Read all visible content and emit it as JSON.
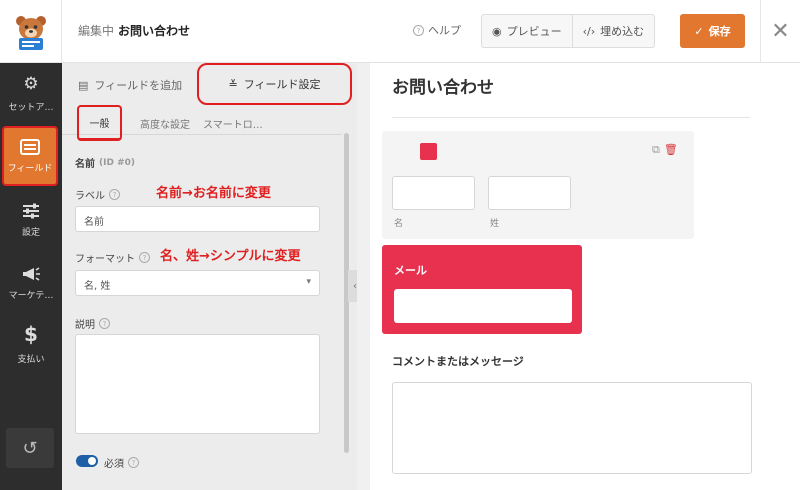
{
  "header": {
    "editing_label": "編集中",
    "form_name": "お問い合わせ",
    "help": "ヘルプ",
    "preview": "プレビュー",
    "embed": "埋め込む",
    "save": "保存",
    "save_color": "#e27730"
  },
  "sidebar": {
    "items": [
      {
        "label": "セットア…",
        "icon": "gear-icon"
      },
      {
        "label": "フィールド",
        "icon": "fields-icon"
      },
      {
        "label": "設定",
        "icon": "sliders-icon"
      },
      {
        "label": "マーケテ…",
        "icon": "megaphone-icon"
      },
      {
        "label": "支払い",
        "icon": "dollar-icon"
      }
    ]
  },
  "panel": {
    "tab_add": "フィールドを追加",
    "tab_options": "フィールド設定",
    "subtabs": [
      "一般",
      "高度な設定",
      "スマートロ…"
    ],
    "field_name": "名前",
    "field_id": "(ID #0)",
    "label_label": "ラベル",
    "label_value": "名前",
    "format_label": "フォーマット",
    "format_value": "名, 姓",
    "description_label": "説明",
    "required_label": "必須"
  },
  "annotations": {
    "label_note": "名前→お名前に変更",
    "format_note": "名、姓→シンプルに変更"
  },
  "preview": {
    "form_title": "お問い合わせ",
    "first_sub_label": "名",
    "last_sub_label": "姓",
    "email_label": "メール",
    "comment_label": "コメントまたはメッセージ",
    "accent_color": "#e8304f"
  }
}
